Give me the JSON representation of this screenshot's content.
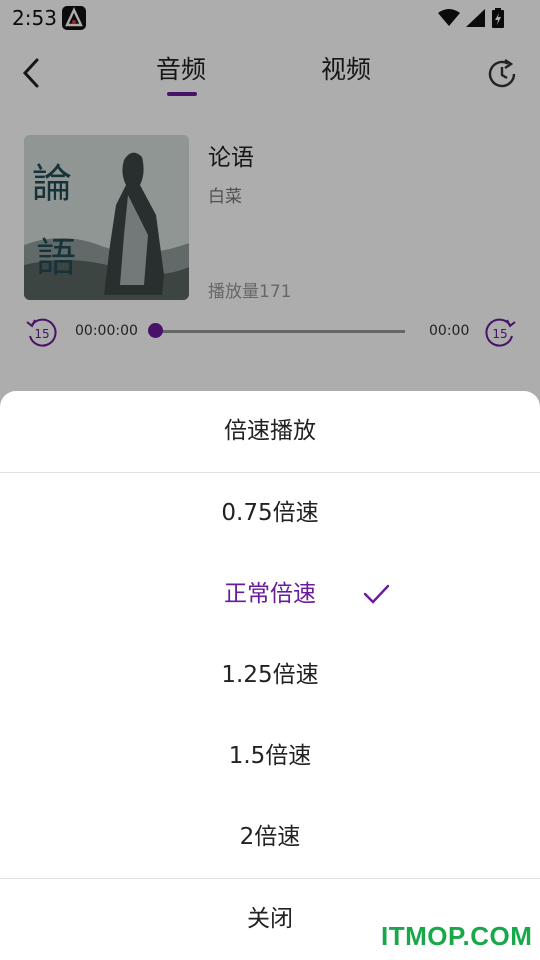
{
  "status_bar": {
    "time": "2:53"
  },
  "header": {
    "tabs": [
      {
        "label": "音频",
        "active": true
      },
      {
        "label": "视频",
        "active": false
      }
    ]
  },
  "album": {
    "cover_text": [
      "論",
      "語"
    ],
    "title": "论语",
    "author": "白菜",
    "play_count": "播放量171"
  },
  "player": {
    "current_time": "00:00:00",
    "total_time": "00:00",
    "rewind_label": "15",
    "forward_label": "15",
    "progress": 0
  },
  "speed_sheet": {
    "title": "倍速播放",
    "options": [
      {
        "label": "0.75倍速",
        "selected": false
      },
      {
        "label": "正常倍速",
        "selected": true
      },
      {
        "label": "1.25倍速",
        "selected": false
      },
      {
        "label": "1.5倍速",
        "selected": false
      },
      {
        "label": "2倍速",
        "selected": false
      }
    ],
    "close_label": "关闭"
  },
  "watermark": "ITMOP.COM",
  "colors": {
    "accent": "#6a1b9a",
    "overlay": "rgba(0,0,0,0.32)",
    "watermark": "#18a84a"
  }
}
